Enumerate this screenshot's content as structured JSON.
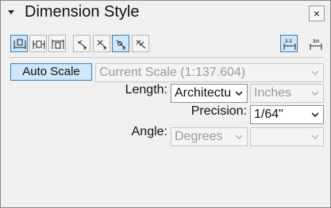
{
  "panel": {
    "title": "Dimension Style",
    "close_glyph": "×",
    "collapse_icon": "triangle-down-icon"
  },
  "toolbar": {
    "left_buttons": [
      {
        "icon": "dim-text-above-icon",
        "selected": true
      },
      {
        "icon": "dim-text-inline-icon",
        "selected": false
      },
      {
        "icon": "dim-text-below-icon",
        "selected": false
      },
      {
        "icon": "dim-slash-1-icon",
        "selected": false
      },
      {
        "icon": "dim-slash-2-icon",
        "selected": false
      },
      {
        "icon": "dim-slash-3-icon",
        "selected": true
      },
      {
        "icon": "dim-slash-4-icon",
        "selected": false
      }
    ],
    "right_buttons": [
      {
        "icon": "scale-3-3-icon",
        "label": "3-3",
        "selected": true
      },
      {
        "icon": "scale-3m-icon",
        "label": "3m",
        "selected": false
      }
    ]
  },
  "scale": {
    "auto_scale_label": "Auto Scale",
    "current_scale": "Current Scale (1:137.604)"
  },
  "length": {
    "label": "Length:",
    "format": "Architectu",
    "units": "Inches"
  },
  "precision": {
    "label": "Precision:",
    "value": "1/64\""
  },
  "angle": {
    "label": "Angle:",
    "units": "Degrees",
    "precision": ""
  }
}
